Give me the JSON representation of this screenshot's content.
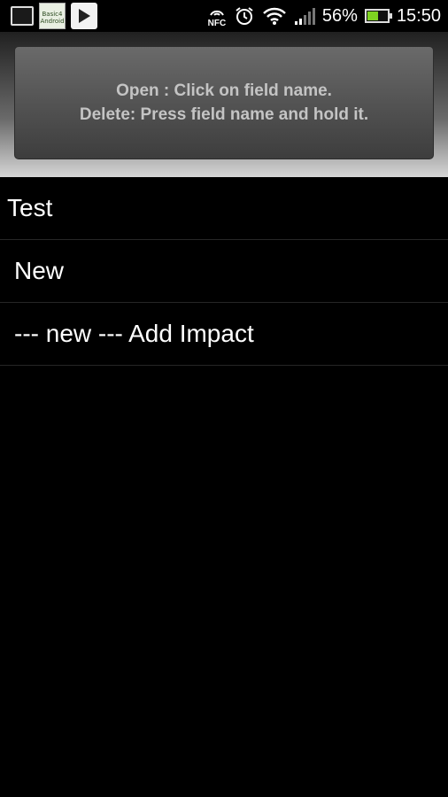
{
  "status_bar": {
    "icons_left": [
      "notification-card-icon",
      "basic4android-app-icon",
      "play-store-icon"
    ],
    "app_thumb_text": "Basic4 Android",
    "nfc_label": "NFC",
    "battery_percent": "56%",
    "battery_level": 0.56,
    "time": "15:50",
    "accent_battery": "#7ed321"
  },
  "help": {
    "line1": "Open : Click on field name.",
    "line2": "Delete: Press field name and hold it."
  },
  "list": {
    "items": [
      {
        "label": "Test"
      },
      {
        "label": "New"
      },
      {
        "label": "--- new --- Add Impact"
      }
    ]
  }
}
